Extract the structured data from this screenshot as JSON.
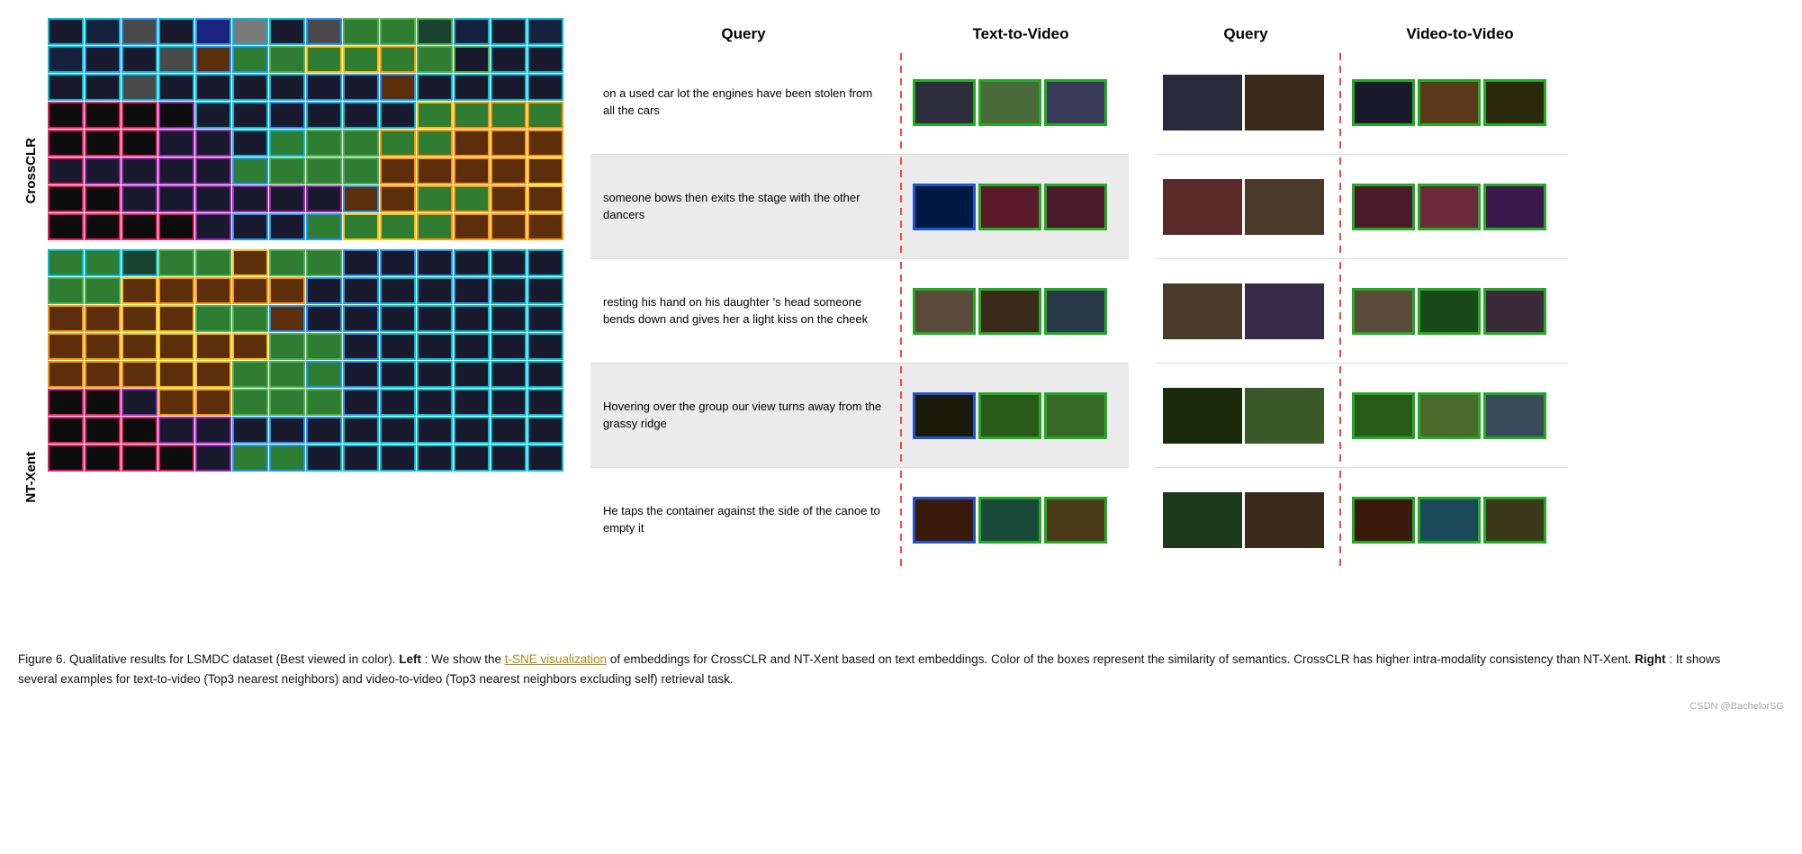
{
  "figure_number": "Figure 6.",
  "caption_main": " Qualitative results for LSMDC dataset (Best viewed in color). ",
  "caption_left_label": "Left",
  "caption_left": ": We show the ",
  "caption_highlight": "t-SNE visualization",
  "caption_middle": " of embeddings for CrossCLR and NT-Xent based on text embeddings. Color of the boxes represent the similarity of semantics. CrossCLR has higher intra-modality consistency than NT-Xent. ",
  "caption_right_label": "Right",
  "caption_right": ": It shows several examples for text-to-video (Top3 nearest neighbors) and video-to-video (Top3 nearest neighbors excluding self) retrieval task.",
  "watermark": "CSDN @BachelorSG",
  "left_label_crossclr": "CrossCLR",
  "left_label_ntxent": "NT-Xent",
  "header_query": "Query",
  "header_ttv": "Text-to-Video",
  "header_query2": "Query",
  "header_vtv": "Video-to-Video",
  "queries": [
    {
      "id": 1,
      "text": "on a used car lot the engines have been stolen from all the cars",
      "highlighted": false
    },
    {
      "id": 2,
      "text": "someone bows then exits the stage with the other dancers",
      "highlighted": true
    },
    {
      "id": 3,
      "text": "resting his hand on his daughter 's head someone bends down and gives her a light kiss on the cheek",
      "highlighted": false
    },
    {
      "id": 4,
      "text": "Hovering over the group our view turns away from the grassy ridge",
      "highlighted": true
    },
    {
      "id": 5,
      "text": "He taps the container against the side of the canoe to empty it",
      "highlighted": false
    }
  ]
}
